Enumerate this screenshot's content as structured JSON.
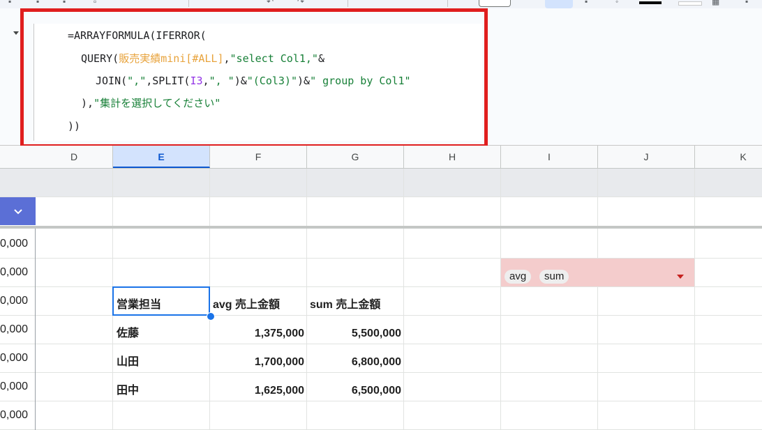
{
  "formula": {
    "line1": "=ARRAYFORMULA(IFERROR(",
    "line2_pre": "QUERY(",
    "line2_range": "販売実績mini[#ALL]",
    "line2_sep": ",",
    "line2_str": "\"select Col1,\"",
    "line2_end": "&",
    "line3_pre": "JOIN(",
    "line3_str1": "\",\"",
    "line3_mid1": ",SPLIT(",
    "line3_ref": "I3",
    "line3_mid2": ",",
    "line3_str2": "\", \"",
    "line3_mid3": ")&",
    "line3_str3": "\"(Col3)\"",
    "line3_mid4": ")&",
    "line3_str4": "\" group by Col1\"",
    "line4_pre": "),",
    "line4_str": "\"集計を選択してください\"",
    "line5": "))"
  },
  "columns": [
    "D",
    "E",
    "F",
    "G",
    "H",
    "I",
    "J",
    "K"
  ],
  "left_values": [
    "0,000",
    "0,000",
    "0,000",
    "0,000",
    "0,000",
    "0,000",
    "0,000"
  ],
  "table": {
    "headers": [
      "営業担当",
      "avg 売上金額",
      "sum 売上金額"
    ],
    "rows": [
      {
        "name": "佐藤",
        "avg": "1,375,000",
        "sum": "5,500,000"
      },
      {
        "name": "山田",
        "avg": "1,700,000",
        "sum": "6,800,000"
      },
      {
        "name": "田中",
        "avg": "1,625,000",
        "sum": "6,500,000"
      }
    ]
  },
  "chips": [
    "avg",
    "sum"
  ],
  "colors": {
    "highlight": "#e01e1e",
    "chip_cell": "#f4cccc",
    "selection": "#1a73e8",
    "dropdown": "#5b6fd6"
  }
}
